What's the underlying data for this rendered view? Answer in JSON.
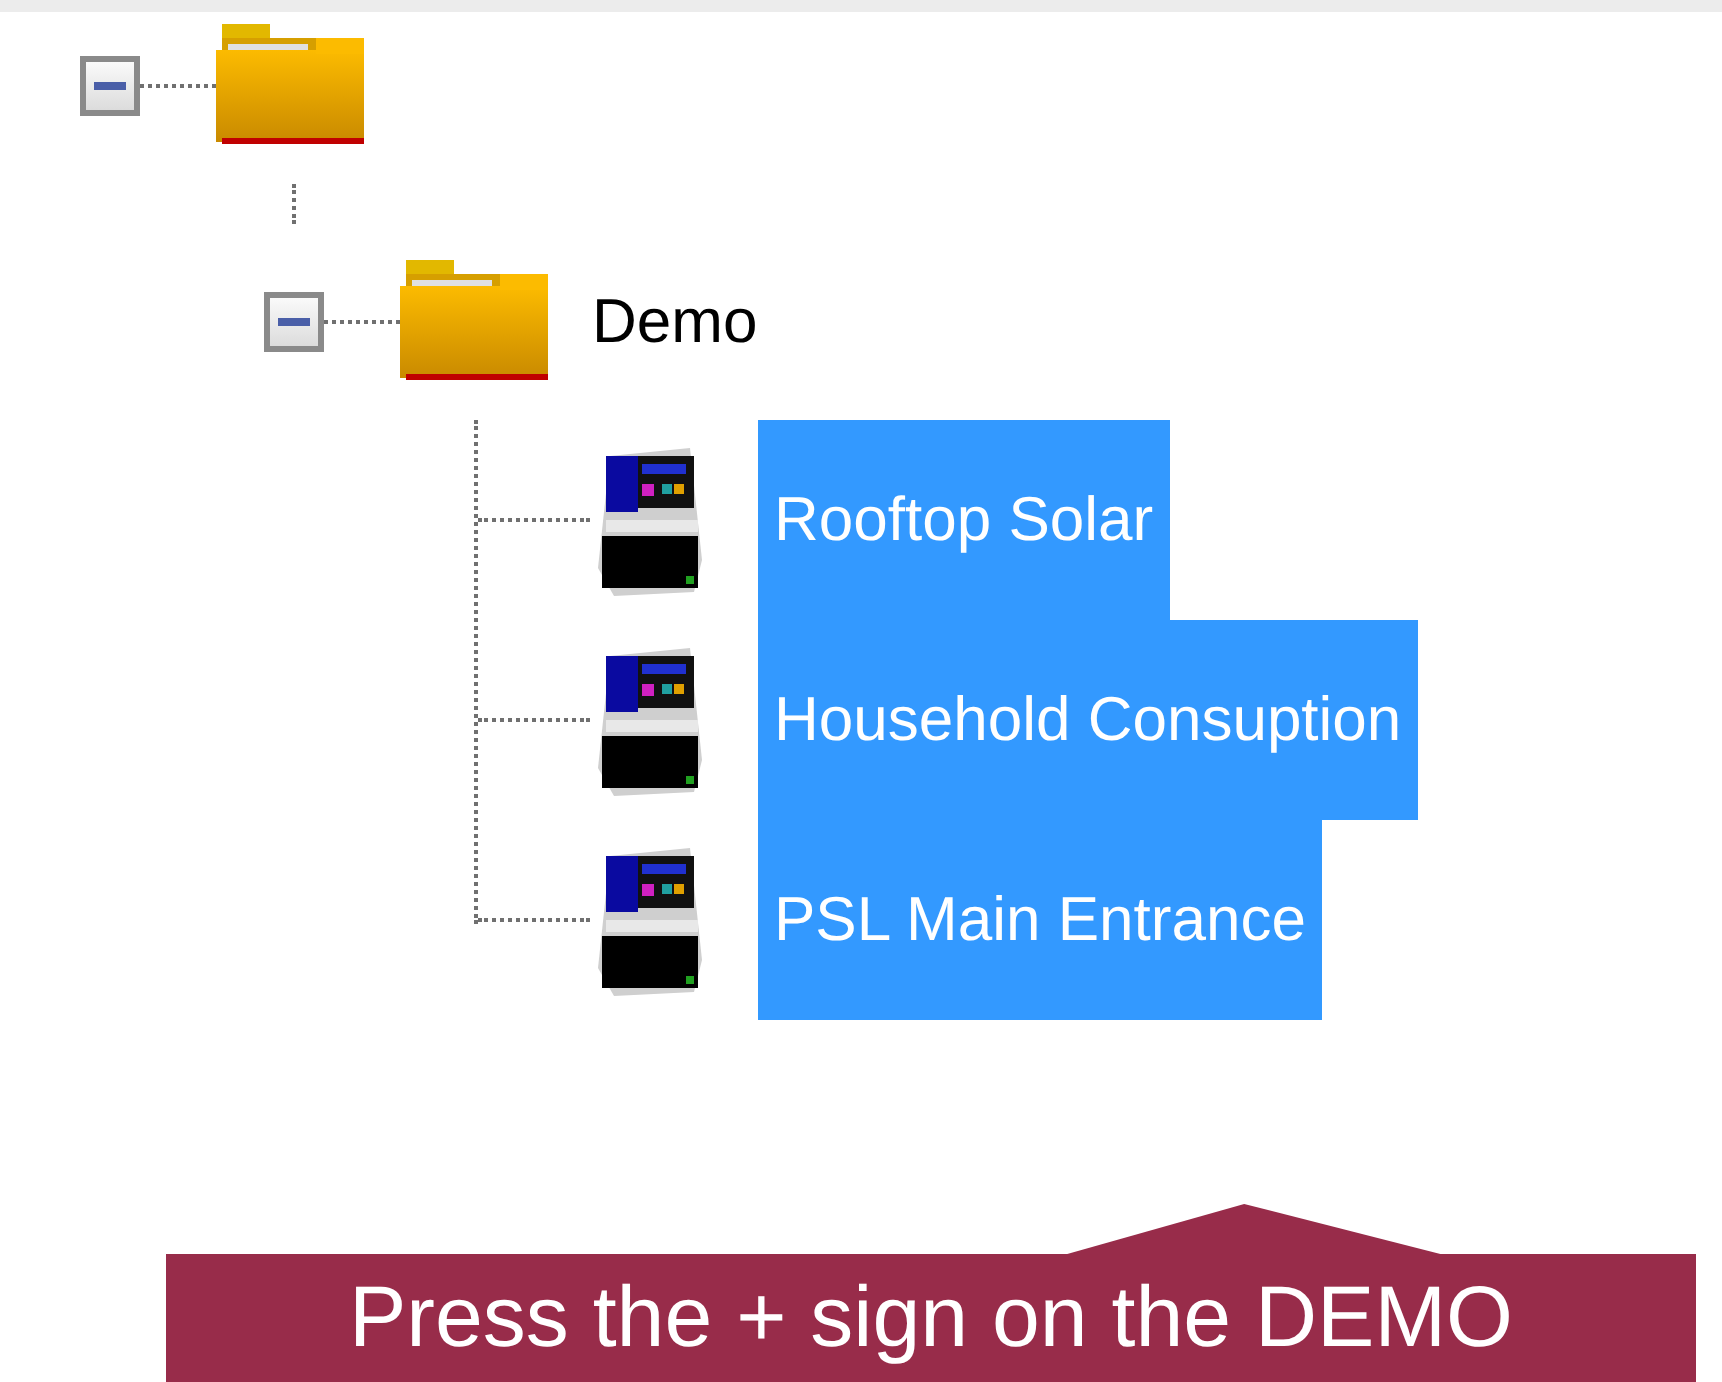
{
  "tree": {
    "nodes": [
      {
        "kind": "folder",
        "expanded": true,
        "children": [
          {
            "kind": "folder",
            "label": "Demo",
            "expanded": true,
            "children": [
              {
                "kind": "device",
                "label": "Rooftop Solar",
                "selected": true
              },
              {
                "kind": "device",
                "label": "Household Consuption",
                "selected": true
              },
              {
                "kind": "device",
                "label": "PSL Main Entrance",
                "selected": true
              }
            ]
          }
        ]
      }
    ]
  },
  "callout": {
    "text": "Press the + sign on the DEMO"
  }
}
